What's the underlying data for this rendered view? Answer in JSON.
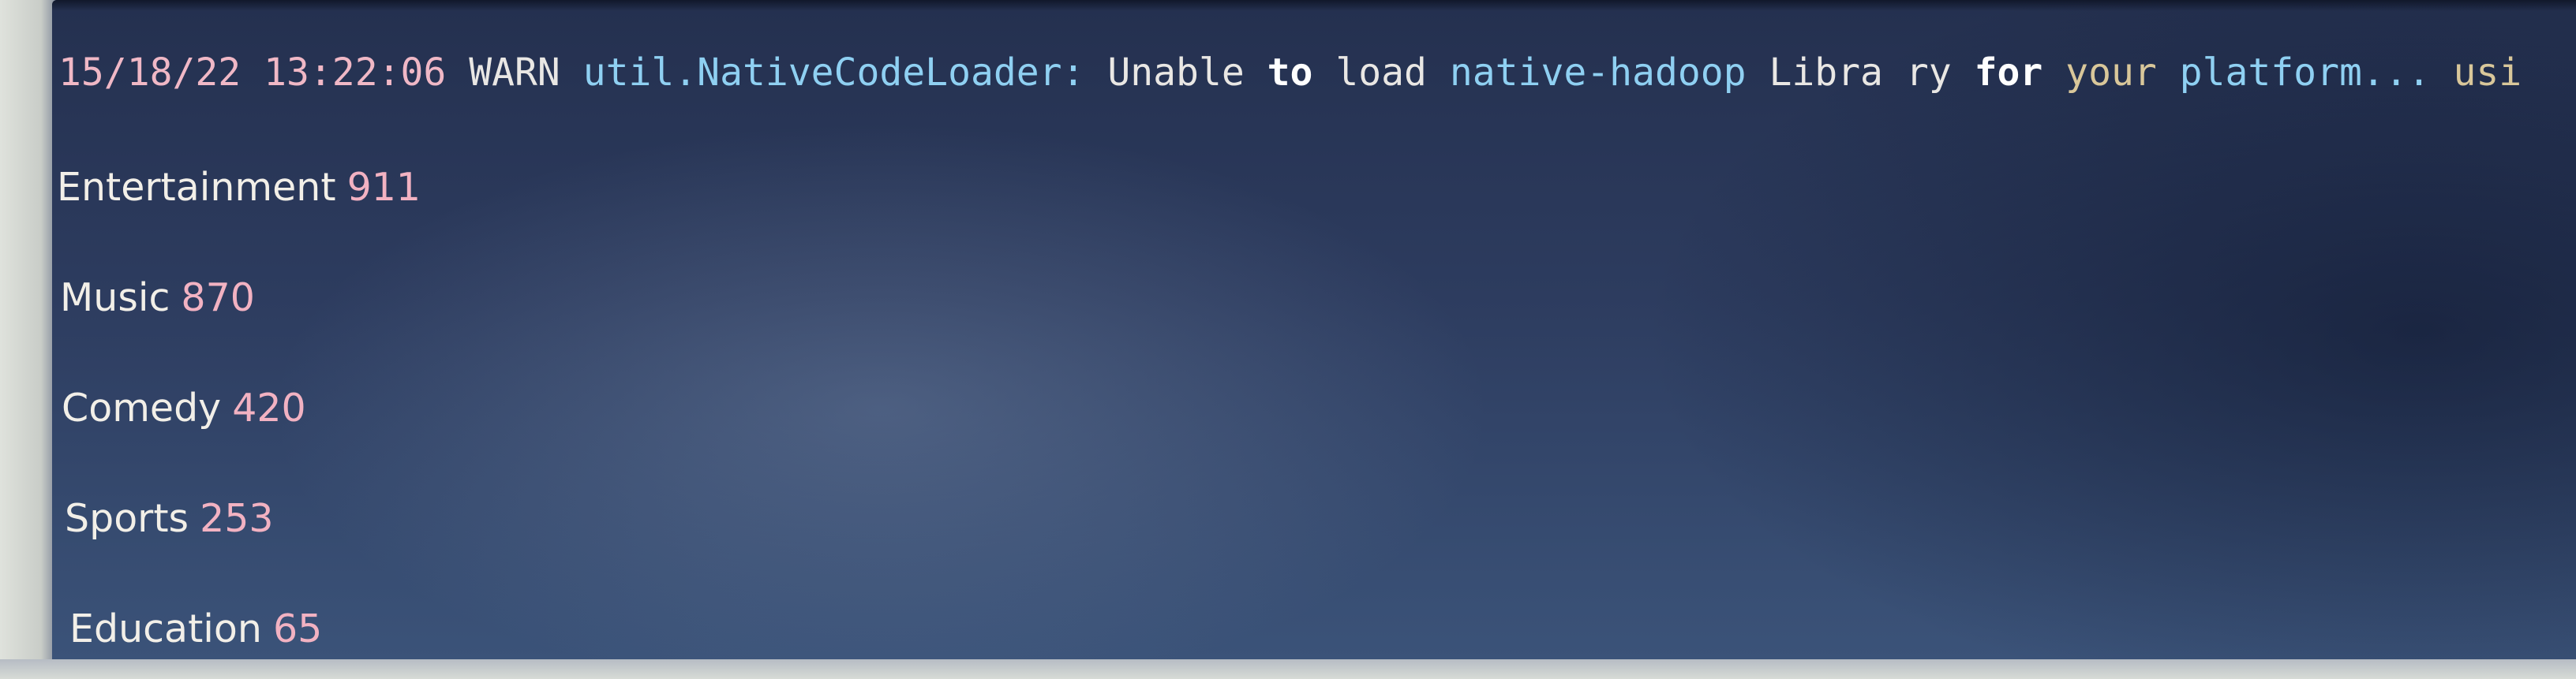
{
  "log_line": {
    "date": "15/18/22",
    "time": "13:22:06",
    "level": "WARN",
    "logger": "util.NativeCodeLoader:",
    "w_unable": "Unable",
    "w_to": "to",
    "w_load": "load",
    "w_native": "native-hadoop",
    "w_libra": "Libra",
    "w_ry": "ry",
    "w_for": "for",
    "w_your": "your",
    "w_platform": "platform...",
    "w_cut": "usi"
  },
  "results": [
    {
      "category": "Entertainment",
      "count": "911"
    },
    {
      "category": "Music",
      "count": "870"
    },
    {
      "category": "Comedy",
      "count": "420"
    },
    {
      "category": "Sports",
      "count": "253"
    },
    {
      "category": "Education",
      "count": "65"
    }
  ],
  "colors": {
    "background": "#2d3c5f",
    "category_text": "#f2efe8",
    "count_text": "#f2b2c2",
    "log_blue": "#8fd0f2",
    "log_date": "#f0b8c6"
  }
}
